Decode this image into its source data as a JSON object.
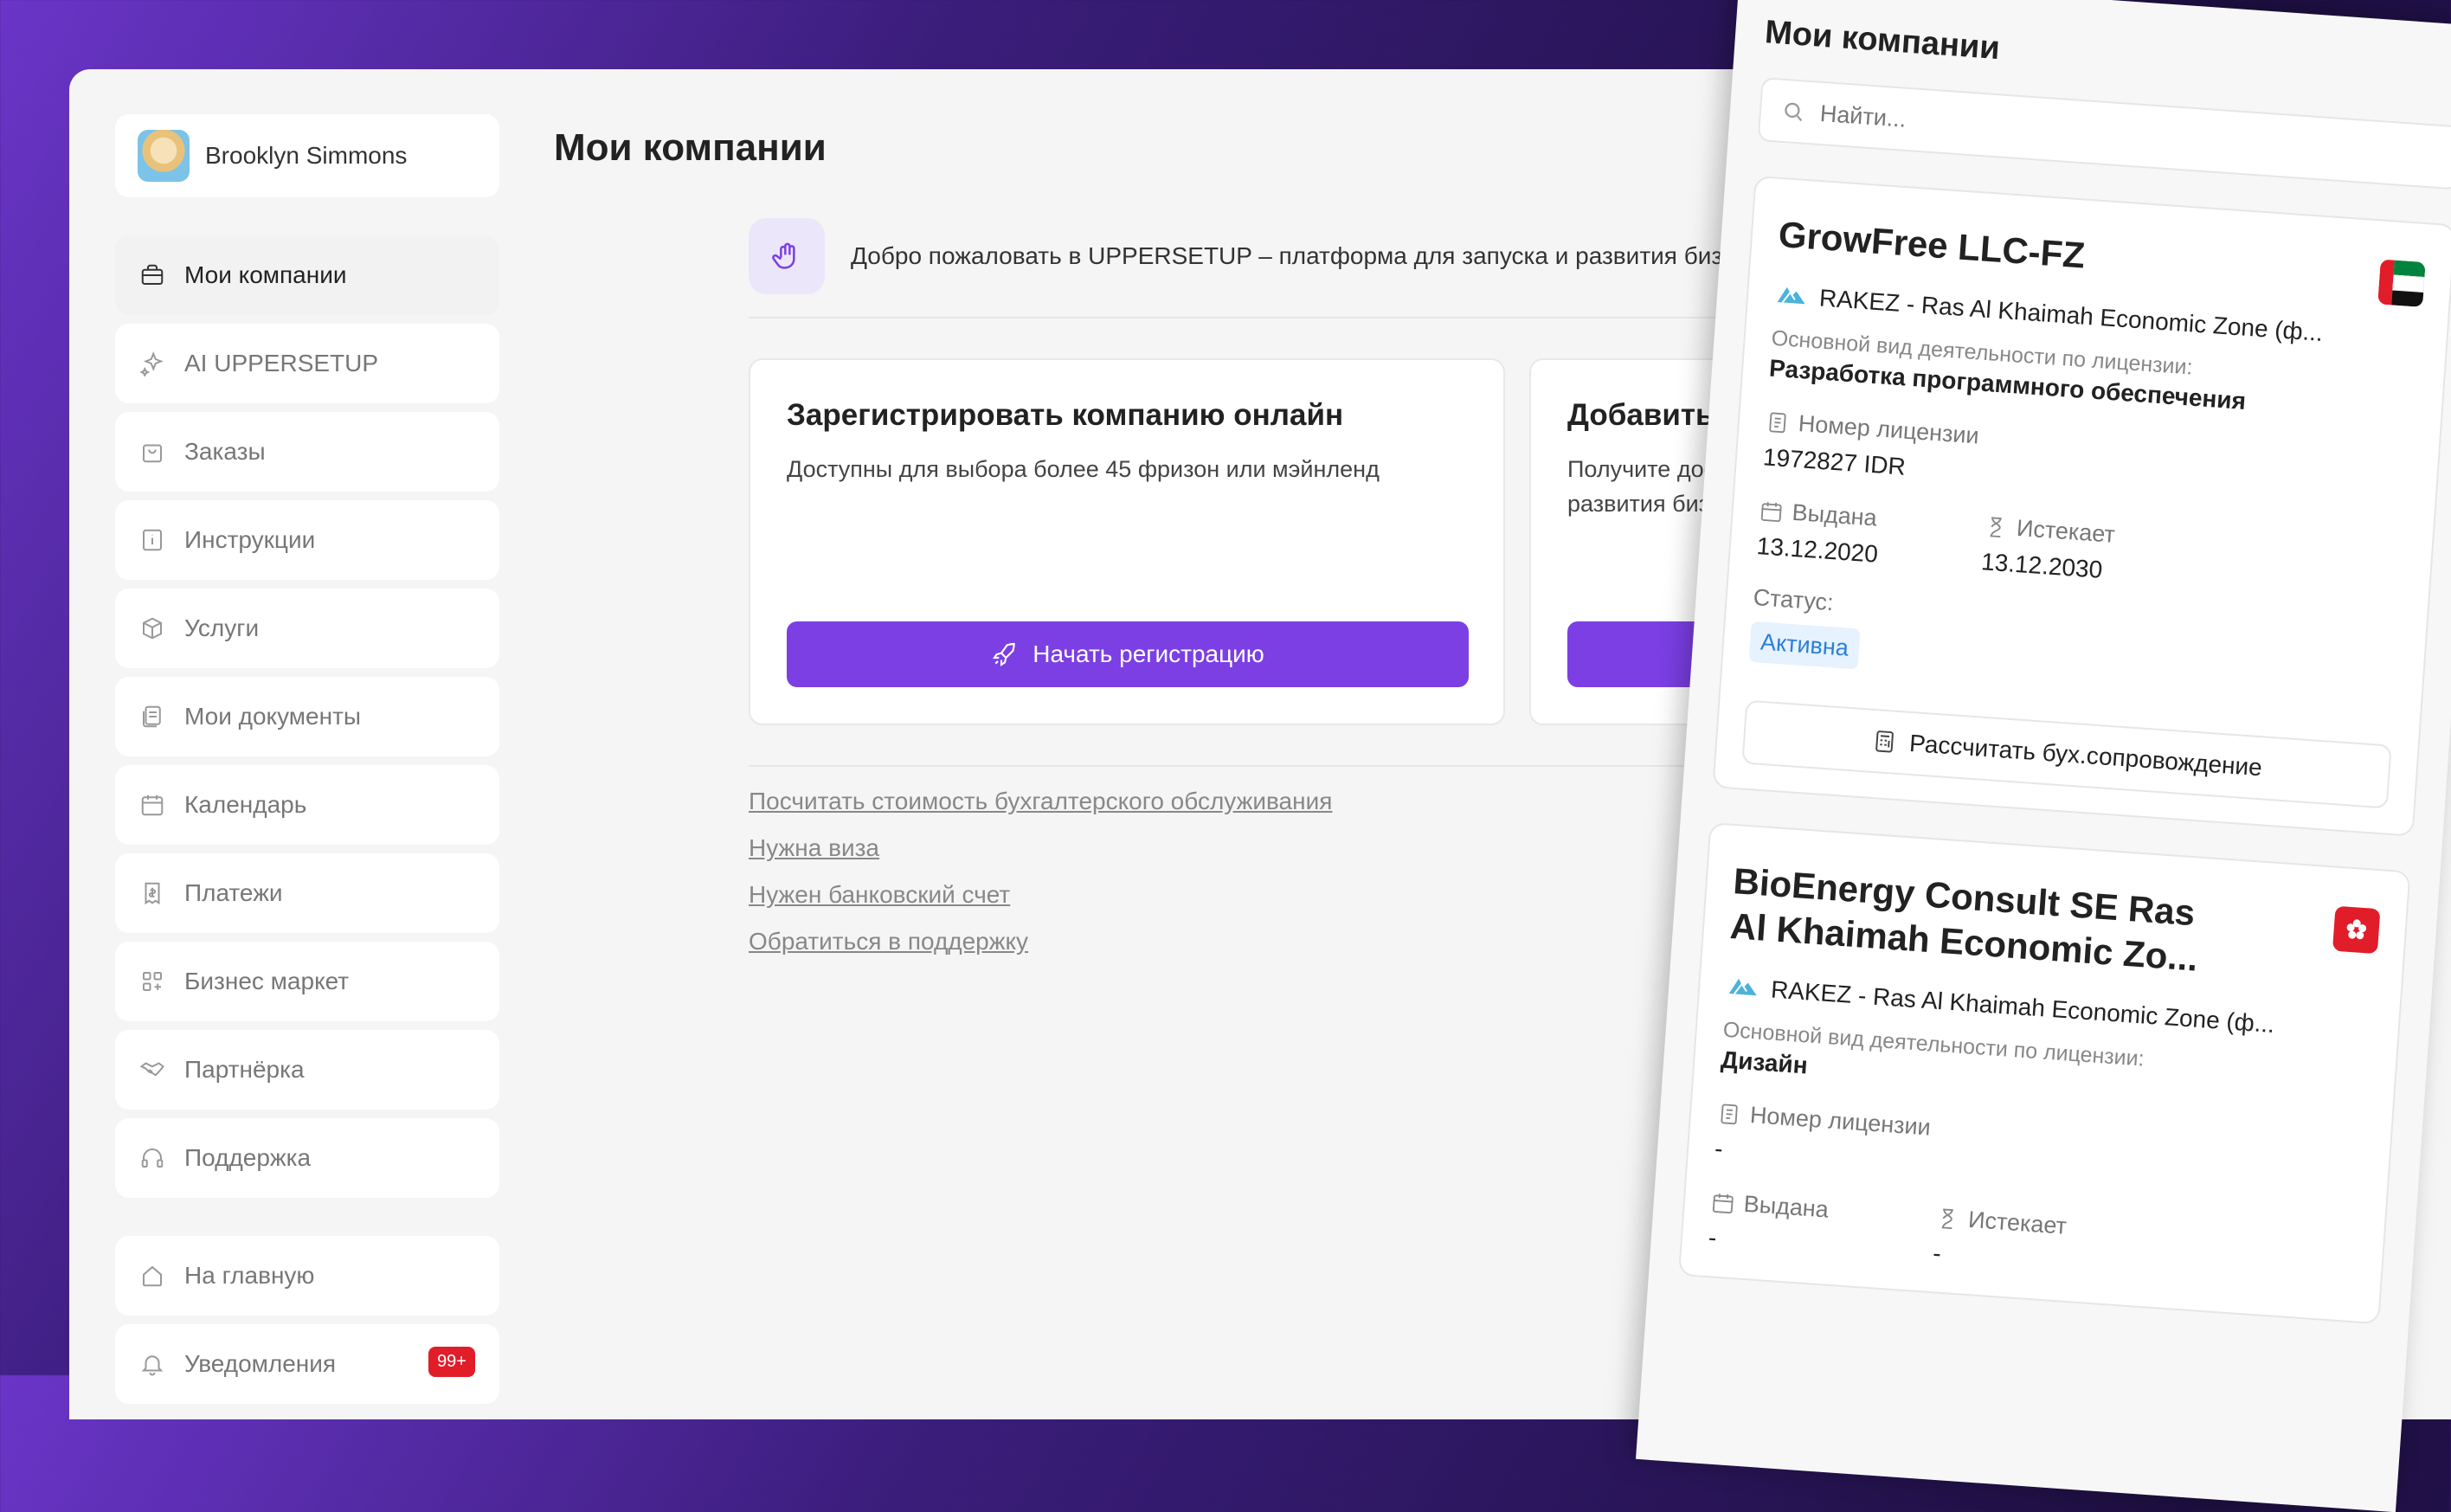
{
  "user": {
    "name": "Brooklyn Simmons"
  },
  "sidebar": {
    "items": [
      {
        "label": "Мои компании",
        "icon": "briefcase-icon"
      },
      {
        "label": "AI UPPERSETUP",
        "icon": "sparkles-icon"
      },
      {
        "label": "Заказы",
        "icon": "shopping-bag-icon"
      },
      {
        "label": "Инструкции",
        "icon": "info-book-icon"
      },
      {
        "label": "Услуги",
        "icon": "box-icon"
      },
      {
        "label": "Мои документы",
        "icon": "documents-icon"
      },
      {
        "label": "Календарь",
        "icon": "calendar-icon"
      },
      {
        "label": "Платежи",
        "icon": "receipt-icon"
      },
      {
        "label": "Бизнес маркет",
        "icon": "apps-grid-icon"
      },
      {
        "label": "Партнёрка",
        "icon": "handshake-icon"
      },
      {
        "label": "Поддержка",
        "icon": "headset-icon"
      }
    ],
    "home": {
      "label": "На главную",
      "icon": "home-icon"
    },
    "notifications": {
      "label": "Уведомления",
      "icon": "bell-icon",
      "badge": "99+"
    }
  },
  "main": {
    "title": "Мои компании",
    "welcome_text": "Добро пожаловать в UPPERSETUP – платформа для запуска и развития бизнеса",
    "cards": [
      {
        "title": "Зарегистрировать компанию онлайн",
        "description": "Доступны для выбора более 45 фризон или мэйнленд",
        "button": "Начать регистрацию"
      },
      {
        "title": "Добавить дейс",
        "description_line1": "Получите доступ к",
        "description_line2": "развития бизнеса",
        "button": ""
      }
    ],
    "links": [
      "Посчитать стоимость бухгалтерского обслуживания",
      "Нужна виза",
      "Нужен банковский счет",
      "Обратиться в поддержку"
    ]
  },
  "panel": {
    "title": "Мои компании",
    "search_placeholder": "Найти...",
    "companies": [
      {
        "name": "GrowFree LLC-FZ",
        "flag": "UAE",
        "zone": "RAKEZ - Ras Al Khaimah Economic Zone (ф...",
        "activity_label": "Основной вид деятельности по лицензии:",
        "activity": "Разработка программного обеспечения",
        "license_label": "Номер лицензии",
        "license": "1972827 IDR",
        "issued_label": "Выдана",
        "issued": "13.12.2020",
        "expires_label": "Истекает",
        "expires": "13.12.2030",
        "status_label": "Статус:",
        "status": "Активна",
        "calc_button": "Рассчитать бух.сопровождение"
      },
      {
        "name": "BioEnergy Consult SE Ras Al Khaimah Economic Zo...",
        "flag": "Hong Kong",
        "zone": "RAKEZ - Ras Al Khaimah Economic Zone (ф...",
        "activity_label": "Основной вид деятельности по лицензии:",
        "activity": "Дизайн",
        "license_label": "Номер лицензии",
        "license": "-",
        "issued_label": "Выдана",
        "issued": "-",
        "expires_label": "Истекает",
        "expires": "-"
      }
    ]
  },
  "colors": {
    "accent": "#7b3fe4",
    "status_active": "#2b7fd8",
    "badge_red": "#e11d2a"
  }
}
